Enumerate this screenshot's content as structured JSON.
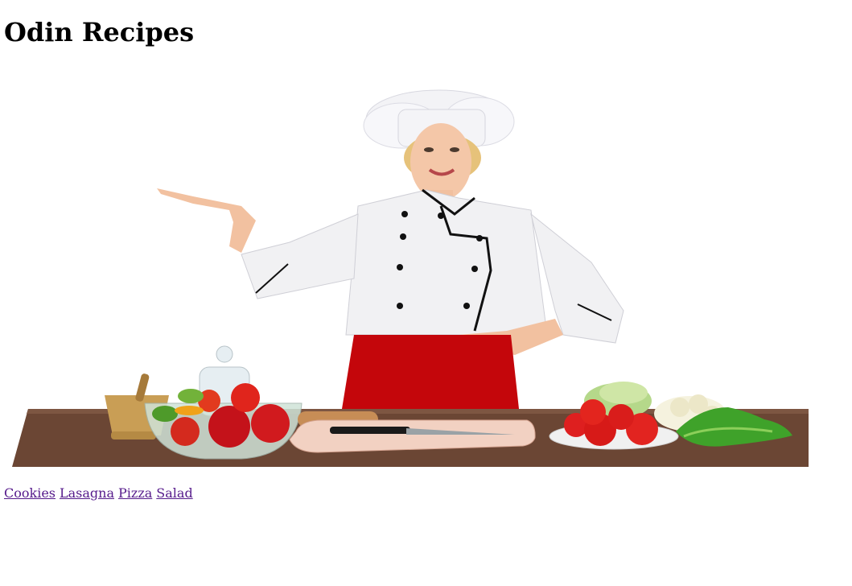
{
  "page": {
    "title": "Odin Recipes"
  },
  "hero_image": {
    "description_icon": "chef-illustration"
  },
  "nav_links": [
    {
      "label": "Cookies"
    },
    {
      "label": "Lasagna"
    },
    {
      "label": "Pizza"
    },
    {
      "label": "Salad"
    }
  ],
  "colors": {
    "link_visited": "#551a8b",
    "apron": "#c4060b",
    "table": "#6b4634"
  }
}
